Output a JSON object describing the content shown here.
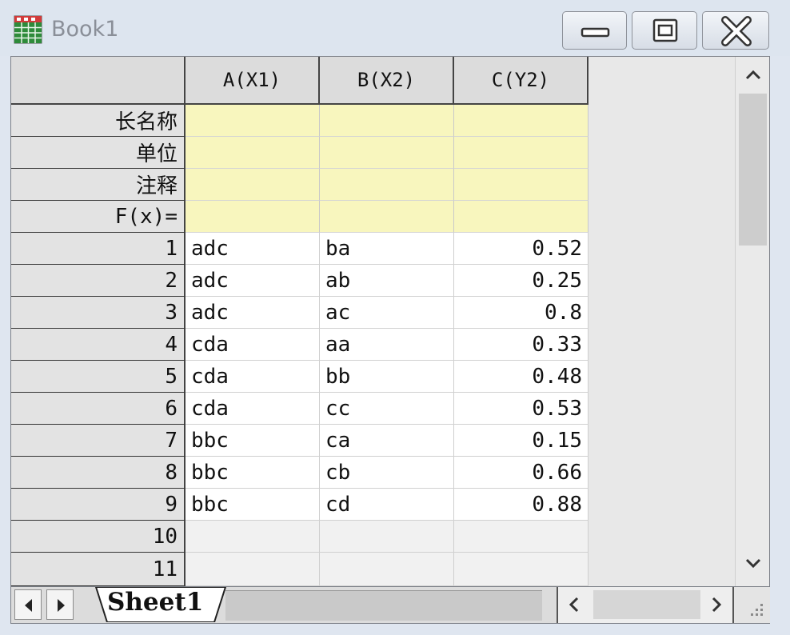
{
  "window": {
    "title": "Book1"
  },
  "columns": [
    "A(X1)",
    "B(X2)",
    "C(Y2)"
  ],
  "meta_rows": [
    "长名称",
    "单位",
    "注释",
    "F(x)="
  ],
  "rows": [
    {
      "num": "1",
      "a": "adc",
      "b": "ba",
      "c": "0.52"
    },
    {
      "num": "2",
      "a": "adc",
      "b": "ab",
      "c": "0.25"
    },
    {
      "num": "3",
      "a": "adc",
      "b": "ac",
      "c": "0.8"
    },
    {
      "num": "4",
      "a": "cda",
      "b": "aa",
      "c": "0.33"
    },
    {
      "num": "5",
      "a": "cda",
      "b": "bb",
      "c": "0.48"
    },
    {
      "num": "6",
      "a": "cda",
      "b": "cc",
      "c": "0.53"
    },
    {
      "num": "7",
      "a": "bbc",
      "b": "ca",
      "c": "0.15"
    },
    {
      "num": "8",
      "a": "bbc",
      "b": "cb",
      "c": "0.66"
    },
    {
      "num": "9",
      "a": "bbc",
      "b": "cd",
      "c": "0.88"
    },
    {
      "num": "10",
      "a": "",
      "b": "",
      "c": ""
    },
    {
      "num": "11",
      "a": "",
      "b": "",
      "c": ""
    }
  ],
  "tabs": [
    {
      "label": "Sheet1"
    }
  ],
  "icons": {
    "app": "worksheet-grid-icon",
    "minimize": "minimize-icon",
    "maximize": "maximize-icon",
    "close": "close-icon",
    "scroll_up": "chevron-up-icon",
    "scroll_down": "chevron-down-icon",
    "tab_prev": "triangle-left-icon",
    "tab_next": "triangle-right-icon",
    "scroll_left": "chevron-left-icon",
    "scroll_right": "chevron-right-icon",
    "resize": "resize-grip-icon"
  },
  "colors": {
    "meta_row_bg": "#f8f6be",
    "header_bg": "#dcdcdc",
    "title_text": "#8a8f98",
    "icon_green": "#2e8b3a",
    "icon_red": "#d23b3b"
  }
}
